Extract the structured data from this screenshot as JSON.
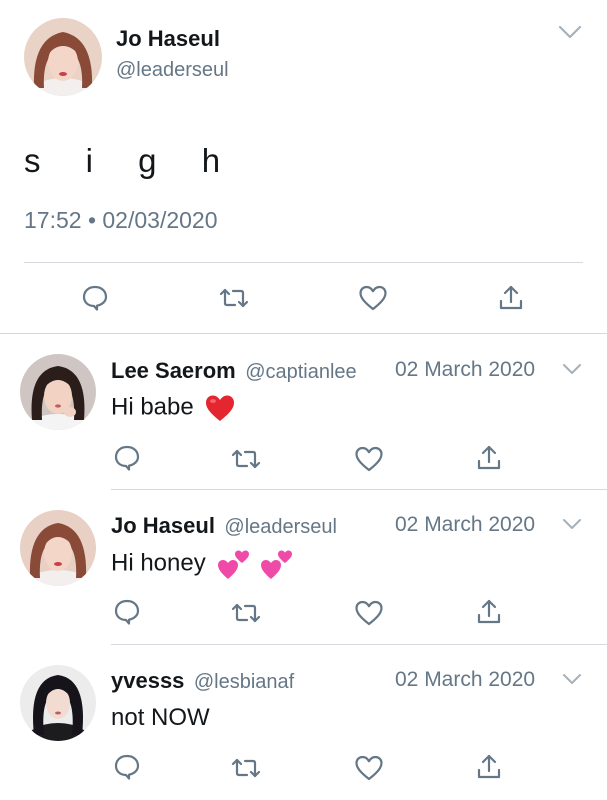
{
  "main_tweet": {
    "author_name": "Jo Haseul",
    "author_handle": "@leaderseul",
    "text": "s i g h",
    "timestamp": "17:52 • 02/03/2020",
    "icons": {
      "menu": "chevron-down-icon",
      "reply": "reply-icon",
      "retweet": "retweet-icon",
      "like": "heart-icon",
      "share": "share-icon"
    }
  },
  "replies": [
    {
      "author_name": "Lee Saerom",
      "author_handle": "@captianlee",
      "date": "02 March 2020",
      "text": "Hi babe",
      "emoji": [
        "red-heart"
      ]
    },
    {
      "author_name": "Jo Haseul",
      "author_handle": "@leaderseul",
      "date": "02 March 2020",
      "text": "Hi honey",
      "emoji": [
        "two-hearts",
        "two-hearts"
      ]
    },
    {
      "author_name": "yvesss",
      "author_handle": "@lesbianaf",
      "date": "02 March 2020",
      "text": "not NOW",
      "emoji": []
    }
  ],
  "colors": {
    "text": "#14171a",
    "muted": "#657786",
    "icon": "#657786",
    "divider": "#d5d9dd",
    "heart_red": "#e0245e",
    "pink_heart": "#f04aa8"
  }
}
